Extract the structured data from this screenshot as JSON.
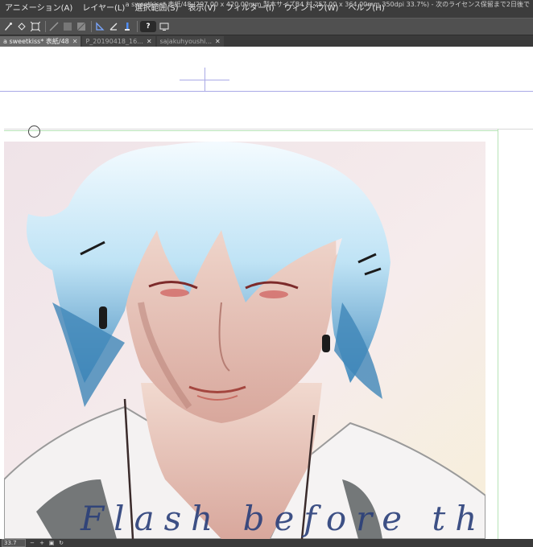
{
  "window_title": "a sweetkiss* 表紙/48 (297.00 x 420.00mm 製本サイズB4 村 257.00 x 364.00mm 350dpi 33.7%) - 次のライセンス保留まで2日後で",
  "menu": [
    "アニメーション(A)",
    "レイヤー(L)",
    "選択範囲(S)",
    "表示(V)",
    "フィルター(I)",
    "ウィンドウ(W)",
    "ヘルプ(H)"
  ],
  "toolbar_icons": [
    "brush-icon",
    "fill-icon",
    "transform-icon",
    "layer-icon",
    "layer2-icon",
    "layer3-icon",
    "ruler-icon",
    "snap-icon",
    "pen-icon",
    "help-icon",
    "screen-icon"
  ],
  "help_label": "?",
  "tabs": [
    {
      "label": "a sweetkiss* 表紙/48",
      "active": true
    },
    {
      "label": "P_20190418_16...",
      "active": false
    },
    {
      "label": "sajakuhyoushi...",
      "active": false
    }
  ],
  "artwork_caption": "Flash before the cigar",
  "status": {
    "zoom": "33.7"
  },
  "colors": {
    "menubar": "#3c3c3c",
    "toolbar": "#505050",
    "canvas": "#ffffff",
    "guide_green": "#b7e3b7",
    "guide_blue": "#a9a9e6"
  }
}
